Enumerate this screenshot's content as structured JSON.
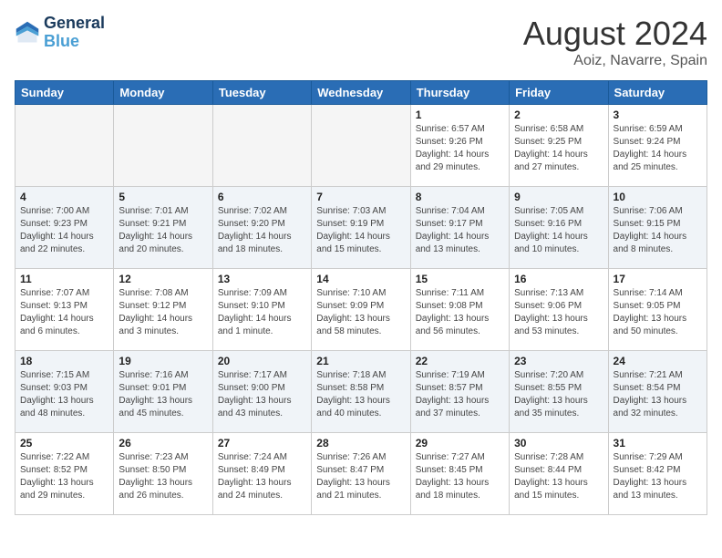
{
  "header": {
    "logo_line1": "General",
    "logo_line2": "Blue",
    "month": "August 2024",
    "location": "Aoiz, Navarre, Spain"
  },
  "weekdays": [
    "Sunday",
    "Monday",
    "Tuesday",
    "Wednesday",
    "Thursday",
    "Friday",
    "Saturday"
  ],
  "weeks": [
    [
      {
        "day": "",
        "empty": true
      },
      {
        "day": "",
        "empty": true
      },
      {
        "day": "",
        "empty": true
      },
      {
        "day": "",
        "empty": true
      },
      {
        "day": "1",
        "sunrise": "6:57 AM",
        "sunset": "9:26 PM",
        "daylight": "14 hours and 29 minutes."
      },
      {
        "day": "2",
        "sunrise": "6:58 AM",
        "sunset": "9:25 PM",
        "daylight": "14 hours and 27 minutes."
      },
      {
        "day": "3",
        "sunrise": "6:59 AM",
        "sunset": "9:24 PM",
        "daylight": "14 hours and 25 minutes."
      }
    ],
    [
      {
        "day": "4",
        "sunrise": "7:00 AM",
        "sunset": "9:23 PM",
        "daylight": "14 hours and 22 minutes."
      },
      {
        "day": "5",
        "sunrise": "7:01 AM",
        "sunset": "9:21 PM",
        "daylight": "14 hours and 20 minutes."
      },
      {
        "day": "6",
        "sunrise": "7:02 AM",
        "sunset": "9:20 PM",
        "daylight": "14 hours and 18 minutes."
      },
      {
        "day": "7",
        "sunrise": "7:03 AM",
        "sunset": "9:19 PM",
        "daylight": "14 hours and 15 minutes."
      },
      {
        "day": "8",
        "sunrise": "7:04 AM",
        "sunset": "9:17 PM",
        "daylight": "14 hours and 13 minutes."
      },
      {
        "day": "9",
        "sunrise": "7:05 AM",
        "sunset": "9:16 PM",
        "daylight": "14 hours and 10 minutes."
      },
      {
        "day": "10",
        "sunrise": "7:06 AM",
        "sunset": "9:15 PM",
        "daylight": "14 hours and 8 minutes."
      }
    ],
    [
      {
        "day": "11",
        "sunrise": "7:07 AM",
        "sunset": "9:13 PM",
        "daylight": "14 hours and 6 minutes."
      },
      {
        "day": "12",
        "sunrise": "7:08 AM",
        "sunset": "9:12 PM",
        "daylight": "14 hours and 3 minutes."
      },
      {
        "day": "13",
        "sunrise": "7:09 AM",
        "sunset": "9:10 PM",
        "daylight": "14 hours and 1 minute."
      },
      {
        "day": "14",
        "sunrise": "7:10 AM",
        "sunset": "9:09 PM",
        "daylight": "13 hours and 58 minutes."
      },
      {
        "day": "15",
        "sunrise": "7:11 AM",
        "sunset": "9:08 PM",
        "daylight": "13 hours and 56 minutes."
      },
      {
        "day": "16",
        "sunrise": "7:13 AM",
        "sunset": "9:06 PM",
        "daylight": "13 hours and 53 minutes."
      },
      {
        "day": "17",
        "sunrise": "7:14 AM",
        "sunset": "9:05 PM",
        "daylight": "13 hours and 50 minutes."
      }
    ],
    [
      {
        "day": "18",
        "sunrise": "7:15 AM",
        "sunset": "9:03 PM",
        "daylight": "13 hours and 48 minutes."
      },
      {
        "day": "19",
        "sunrise": "7:16 AM",
        "sunset": "9:01 PM",
        "daylight": "13 hours and 45 minutes."
      },
      {
        "day": "20",
        "sunrise": "7:17 AM",
        "sunset": "9:00 PM",
        "daylight": "13 hours and 43 minutes."
      },
      {
        "day": "21",
        "sunrise": "7:18 AM",
        "sunset": "8:58 PM",
        "daylight": "13 hours and 40 minutes."
      },
      {
        "day": "22",
        "sunrise": "7:19 AM",
        "sunset": "8:57 PM",
        "daylight": "13 hours and 37 minutes."
      },
      {
        "day": "23",
        "sunrise": "7:20 AM",
        "sunset": "8:55 PM",
        "daylight": "13 hours and 35 minutes."
      },
      {
        "day": "24",
        "sunrise": "7:21 AM",
        "sunset": "8:54 PM",
        "daylight": "13 hours and 32 minutes."
      }
    ],
    [
      {
        "day": "25",
        "sunrise": "7:22 AM",
        "sunset": "8:52 PM",
        "daylight": "13 hours and 29 minutes."
      },
      {
        "day": "26",
        "sunrise": "7:23 AM",
        "sunset": "8:50 PM",
        "daylight": "13 hours and 26 minutes."
      },
      {
        "day": "27",
        "sunrise": "7:24 AM",
        "sunset": "8:49 PM",
        "daylight": "13 hours and 24 minutes."
      },
      {
        "day": "28",
        "sunrise": "7:26 AM",
        "sunset": "8:47 PM",
        "daylight": "13 hours and 21 minutes."
      },
      {
        "day": "29",
        "sunrise": "7:27 AM",
        "sunset": "8:45 PM",
        "daylight": "13 hours and 18 minutes."
      },
      {
        "day": "30",
        "sunrise": "7:28 AM",
        "sunset": "8:44 PM",
        "daylight": "13 hours and 15 minutes."
      },
      {
        "day": "31",
        "sunrise": "7:29 AM",
        "sunset": "8:42 PM",
        "daylight": "13 hours and 13 minutes."
      }
    ]
  ]
}
